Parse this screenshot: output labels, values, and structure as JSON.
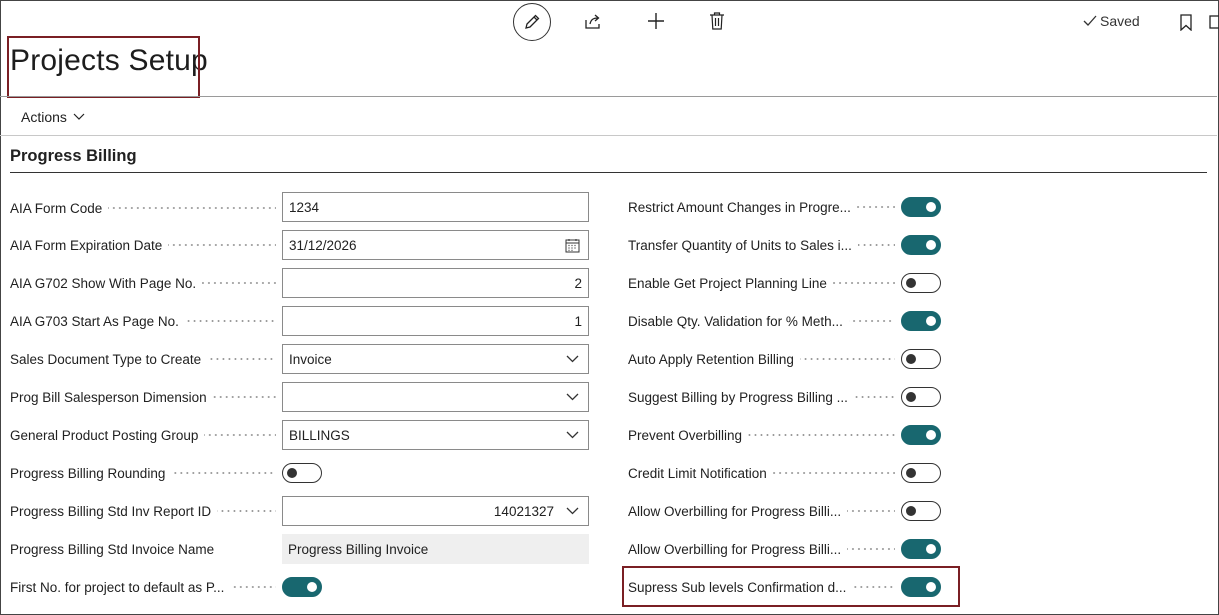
{
  "toolbar": {
    "edit_icon": "pencil-icon",
    "share_icon": "share-icon",
    "new_icon": "plus-icon",
    "delete_icon": "trash-icon",
    "saved_label": "Saved",
    "bookmark_icon": "bookmark-icon",
    "collapse_icon": "collapse-icon"
  },
  "page": {
    "title": "Projects Setup"
  },
  "actions": {
    "label": "Actions"
  },
  "group": {
    "title": "Progress Billing"
  },
  "left_fields": [
    {
      "label": "AIA Form Code",
      "value": "1234"
    },
    {
      "label": "AIA Form Expiration Date",
      "value": "31/12/2026"
    },
    {
      "label": "AIA G702 Show With Page No.",
      "value": "2"
    },
    {
      "label": "AIA G703 Start As Page No.",
      "value": "1"
    },
    {
      "label": "Sales Document Type to Create",
      "value": "Invoice"
    },
    {
      "label": "Prog Bill Salesperson Dimension",
      "value": ""
    },
    {
      "label": "General Product Posting Group",
      "value": "BILLINGS"
    },
    {
      "label": "Progress Billing Rounding",
      "toggle": false
    },
    {
      "label": "Progress Billing Std Inv Report ID",
      "value": "14021327"
    },
    {
      "label": "Progress Billing Std Invoice Name",
      "value": "Progress Billing Invoice"
    },
    {
      "label": "First No. for project to default as P...",
      "toggle": true
    }
  ],
  "right_fields": [
    {
      "label": "Restrict Amount Changes in Progre...",
      "toggle": true
    },
    {
      "label": "Transfer Quantity of Units to Sales i...",
      "toggle": true
    },
    {
      "label": "Enable Get Project Planning Line",
      "toggle": false
    },
    {
      "label": "Disable Qty. Validation for % Meth...",
      "toggle": true
    },
    {
      "label": "Auto Apply Retention Billing",
      "toggle": false
    },
    {
      "label": "Suggest Billing by Progress Billing ...",
      "toggle": false
    },
    {
      "label": "Prevent Overbilling",
      "toggle": true
    },
    {
      "label": "Credit Limit Notification",
      "toggle": false
    },
    {
      "label": "Allow Overbilling for Progress Billi...",
      "toggle": false
    },
    {
      "label": "Allow Overbilling for Progress Billi...",
      "toggle": true
    },
    {
      "label": "Supress Sub levels Confirmation d...",
      "toggle": true
    }
  ],
  "colors": {
    "accent": "#18676f",
    "highlight": "#7a1f24"
  }
}
